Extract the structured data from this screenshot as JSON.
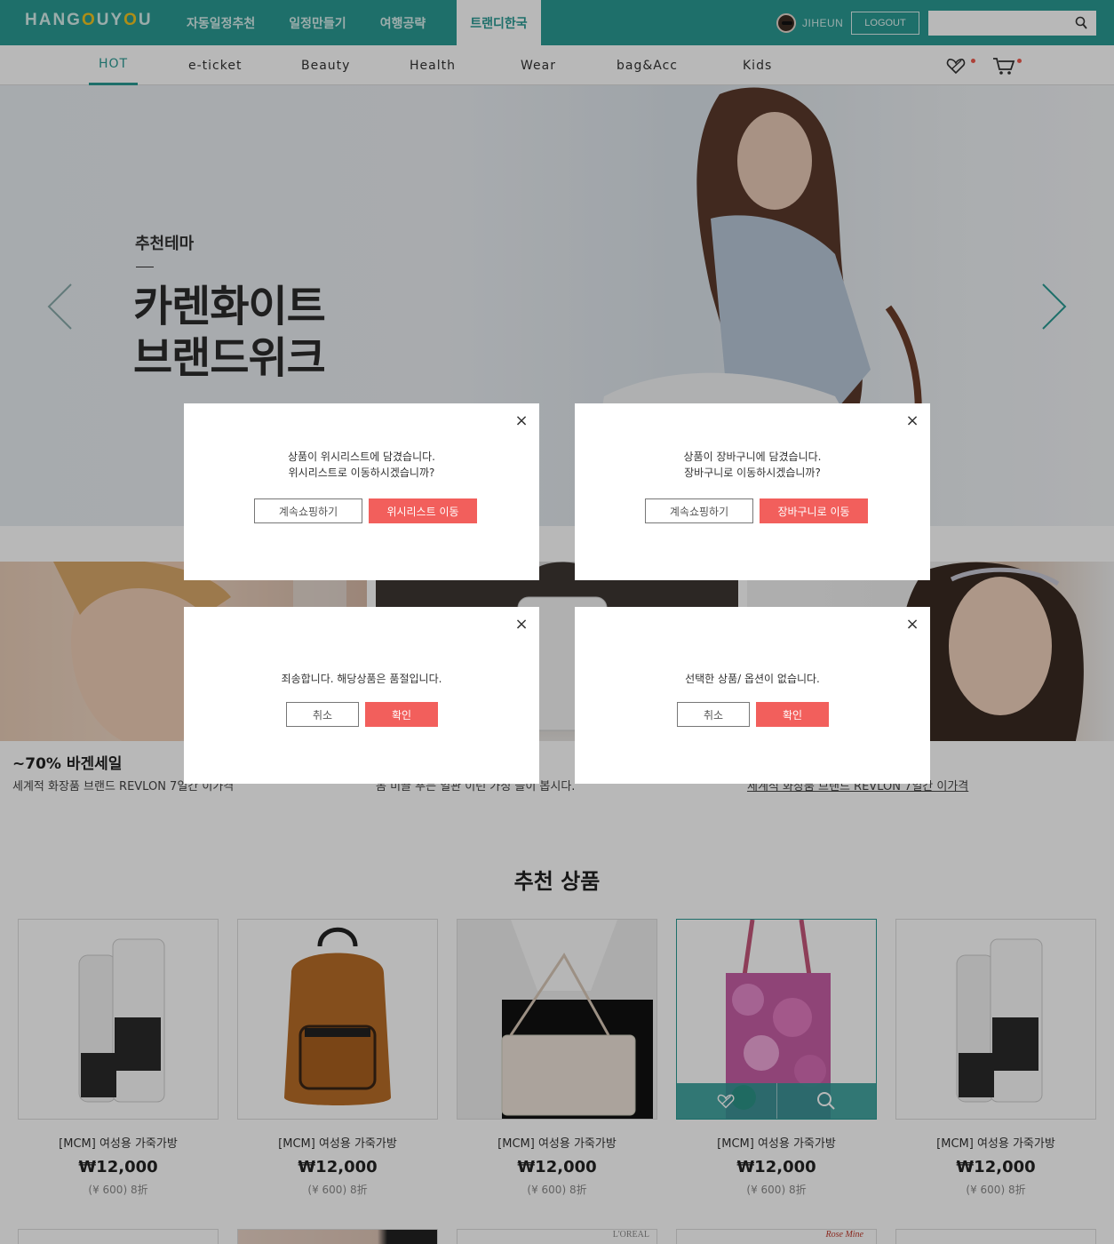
{
  "brand": {
    "logo_text_1": "HANG",
    "logo_o1": "O",
    "logo_text_2": "UY",
    "logo_o2": "O",
    "logo_text_3": "U"
  },
  "main_nav": {
    "items": [
      "자동일정추천",
      "일정만들기",
      "여행공략",
      "트랜디한국"
    ],
    "active_index": 3
  },
  "user": {
    "name": "JIHEUN",
    "logout_label": "LOGOUT"
  },
  "search": {
    "placeholder": "",
    "icon": "search-icon"
  },
  "sub_nav": {
    "tabs": [
      "HOT",
      "e-ticket",
      "Beauty",
      "Health",
      "Wear",
      "bag&Acc",
      "Kids"
    ],
    "active_index": 0
  },
  "hero": {
    "subtitle": "추천테마",
    "title_line1": "카렌화이트",
    "title_line2": "브랜드위크"
  },
  "promos": [
    {
      "title": "~70% 바겐세일",
      "desc": "세계적 화장품 브랜드 REVLON 7일간 이가격"
    },
    {
      "title": "",
      "desc": "몸 미끌 푸는 일관 이런 가정 들이 봅시다."
    },
    {
      "title": "",
      "desc": "세계적 화장품 브랜드 REVLON 7일간 이가격"
    }
  ],
  "recommended": {
    "title": "추천 상품",
    "products": [
      {
        "name": "[MCM] 여성용 가죽가방",
        "price": "₩12,000",
        "sub": "(¥ 600) 8折",
        "image": "shampoo-bottles"
      },
      {
        "name": "[MCM] 여성용 가죽가방",
        "price": "₩12,000",
        "sub": "(¥ 600) 8折",
        "image": "mcm-backpack"
      },
      {
        "name": "[MCM] 여성용 가죽가방",
        "price": "₩12,000",
        "sub": "(¥ 600) 8折",
        "image": "white-crossbody-bag"
      },
      {
        "name": "[MCM] 여성용 가죽가방",
        "price": "₩12,000",
        "sub": "(¥ 600) 8折",
        "image": "floral-tote-bag"
      },
      {
        "name": "[MCM] 여성용 가죽가방",
        "price": "₩12,000",
        "sub": "(¥ 600) 8折",
        "image": "shampoo-bottles"
      }
    ],
    "row2_labels": [
      "",
      "",
      "L'OREAL",
      "Rose Mine",
      ""
    ]
  },
  "modals": {
    "wishlist": {
      "message": "상품이 위시리스트에 담겼습니다.\n위시리스트로 이동하시겠습니까?",
      "secondary": "계속쇼핑하기",
      "primary": "위시리스트 이동"
    },
    "cart": {
      "message": "상품이 장바구니에 담겼습니다.\n장바구니로 이동하시겠습니까?",
      "secondary": "계속쇼핑하기",
      "primary": "장바구니로 이동"
    },
    "soldout": {
      "message": "죄송합니다. 해당상품은 품절입니다.",
      "secondary": "취소",
      "primary": "확인"
    },
    "no_option": {
      "message": "선택한 상품/ 옵션이 없습니다.",
      "secondary": "취소",
      "primary": "확인"
    },
    "close_glyph": "×"
  },
  "colors": {
    "brand_teal": "#2a9a94",
    "accent_red": "#f25f5c",
    "logo_yellow": "#f2c521"
  }
}
